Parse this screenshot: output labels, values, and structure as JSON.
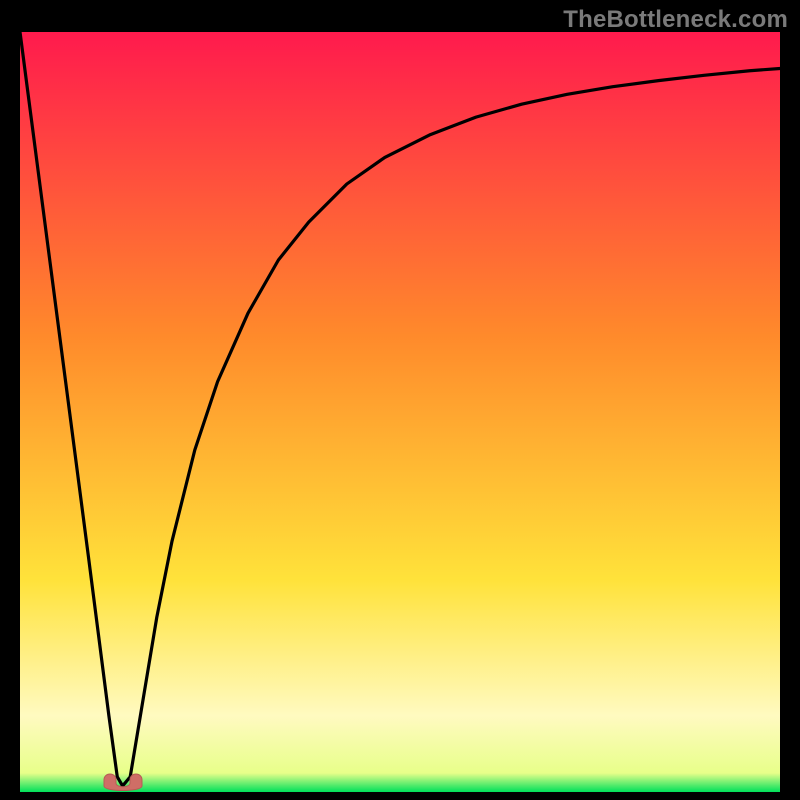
{
  "watermark": "TheBottleneck.com",
  "colors": {
    "bg_black": "#000000",
    "grad_top": "#ff1a4d",
    "grad_mid1": "#ff8a2b",
    "grad_mid2": "#ffe23a",
    "grad_low": "#fffac0",
    "grad_bottom": "#00e05a",
    "curve": "#000000",
    "marker_fill": "#cf6e66",
    "marker_stroke": "#b75c55"
  },
  "chart_data": {
    "type": "line",
    "title": "",
    "xlabel": "",
    "ylabel": "",
    "xlim": [
      0,
      1
    ],
    "ylim": [
      0,
      1
    ],
    "series": [
      {
        "name": "bottleneck-curve",
        "x": [
          0.0,
          0.03,
          0.06,
          0.09,
          0.117,
          0.128,
          0.135,
          0.145,
          0.16,
          0.18,
          0.2,
          0.23,
          0.26,
          0.3,
          0.34,
          0.38,
          0.43,
          0.48,
          0.54,
          0.6,
          0.66,
          0.72,
          0.78,
          0.84,
          0.9,
          0.96,
          1.0
        ],
        "y": [
          1.0,
          0.77,
          0.54,
          0.31,
          0.1,
          0.02,
          0.008,
          0.02,
          0.11,
          0.23,
          0.33,
          0.45,
          0.54,
          0.63,
          0.7,
          0.75,
          0.8,
          0.835,
          0.865,
          0.888,
          0.905,
          0.918,
          0.928,
          0.936,
          0.943,
          0.949,
          0.952
        ]
      }
    ],
    "marker": {
      "x_center": 0.135,
      "y": 0.008,
      "width_frac": 0.06
    },
    "gradient_stops": [
      {
        "pos": 0.0,
        "color": "#ff1a4d"
      },
      {
        "pos": 0.4,
        "color": "#ff8a2b"
      },
      {
        "pos": 0.72,
        "color": "#ffe23a"
      },
      {
        "pos": 0.9,
        "color": "#fffac0"
      },
      {
        "pos": 0.975,
        "color": "#e8ff8a"
      },
      {
        "pos": 1.0,
        "color": "#00e05a"
      }
    ]
  }
}
